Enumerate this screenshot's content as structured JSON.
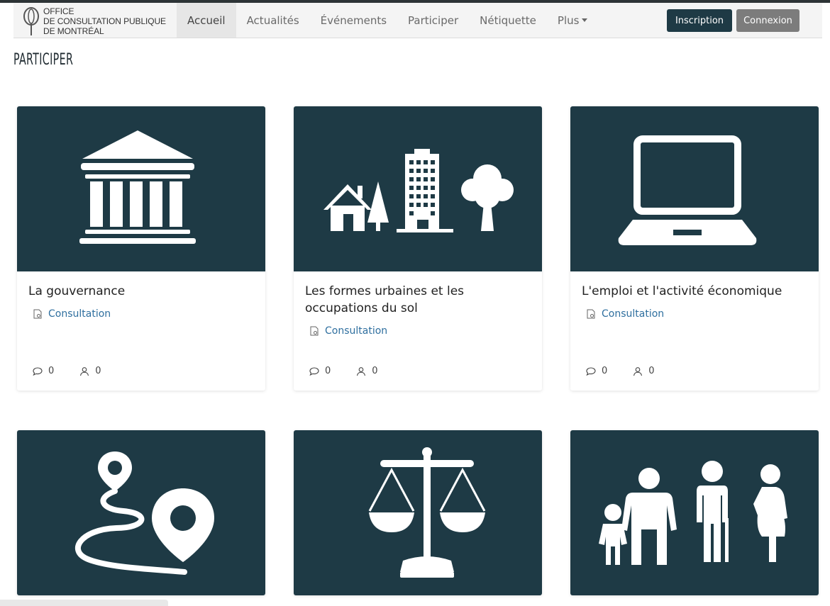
{
  "brand": {
    "line1": "Office",
    "line2": "de consultation publique",
    "line3": "de Montréal",
    "logo_icon": "ocpm-logo-icon"
  },
  "nav": {
    "items": [
      {
        "label": "Accueil",
        "active": true
      },
      {
        "label": "Actualités"
      },
      {
        "label": "Événements"
      },
      {
        "label": "Participer"
      },
      {
        "label": "Nétiquette"
      },
      {
        "label": "Plus"
      }
    ]
  },
  "buttons": {
    "signup": "Inscription",
    "login": "Connexion"
  },
  "page": {
    "title": "PARTICIPER"
  },
  "cards": [
    {
      "title": "La gouvernance",
      "category": "Consultation",
      "comments": "0",
      "participants": "0",
      "icon": "government-building-icon"
    },
    {
      "title": "Les formes urbaines et les occupations du sol",
      "category": "Consultation",
      "comments": "0",
      "participants": "0",
      "icon": "urban-land-use-icon"
    },
    {
      "title": "L'emploi et l'activité économique",
      "category": "Consultation",
      "comments": "0",
      "participants": "0",
      "icon": "laptop-icon"
    },
    {
      "icon": "route-map-pin-icon"
    },
    {
      "icon": "justice-scales-icon"
    },
    {
      "icon": "family-people-icon"
    }
  ],
  "colors": {
    "card_image_bg": "#1e3a45",
    "signup_button": "#1e3a45",
    "login_button": "#7c7c7c",
    "category_link": "#2f6f9f"
  }
}
